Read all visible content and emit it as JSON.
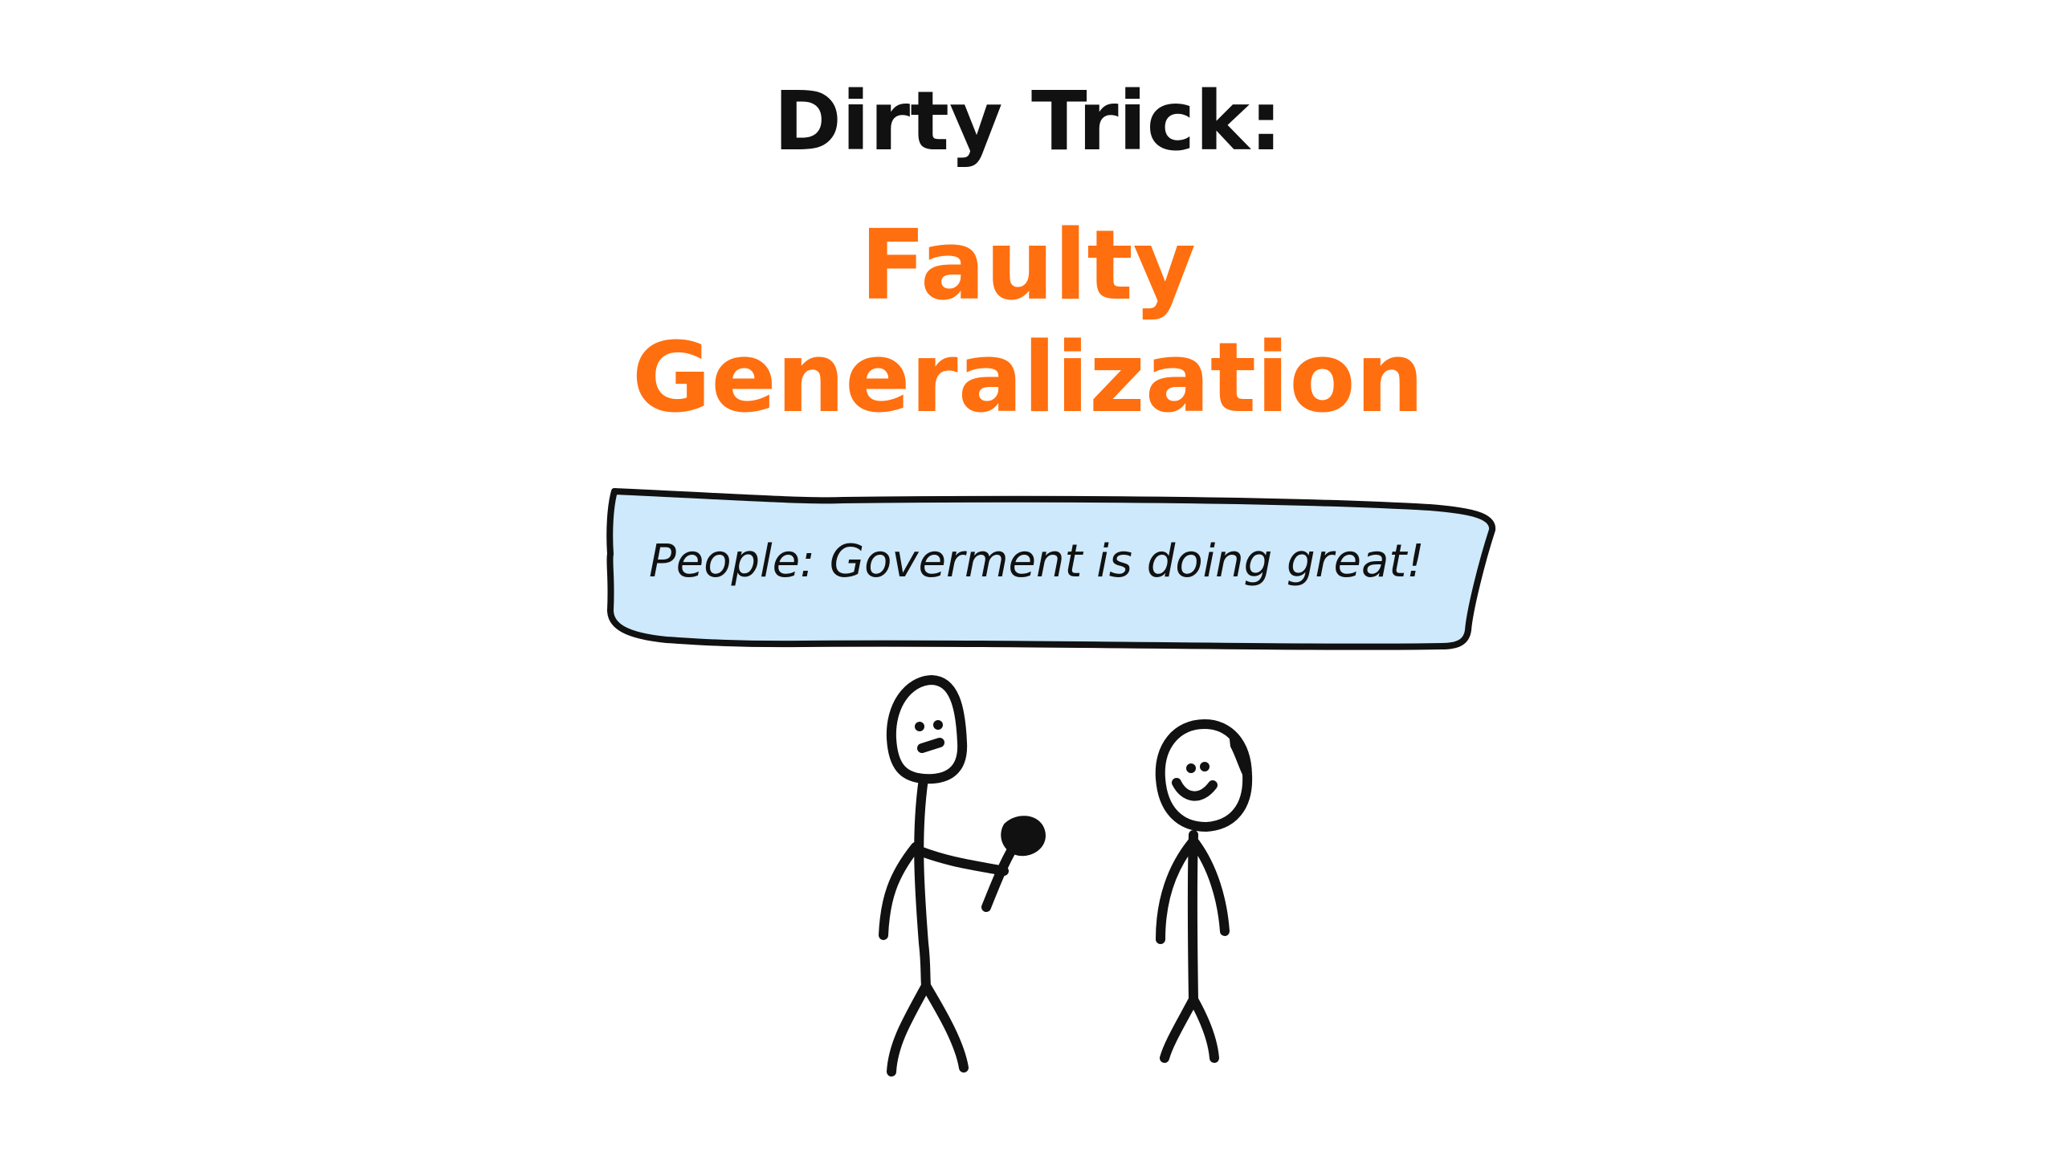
{
  "slide": {
    "kicker": "Dirty Trick:",
    "title_line1": "Faulty",
    "title_line2": "Generalization"
  },
  "bubble": {
    "text": "People: Goverment is doing great!"
  },
  "colors": {
    "kicker": "#111111",
    "title": "#ff6f0f",
    "bubble_fill": "#cde9fb",
    "ink": "#111111",
    "background": "#ffffff"
  }
}
